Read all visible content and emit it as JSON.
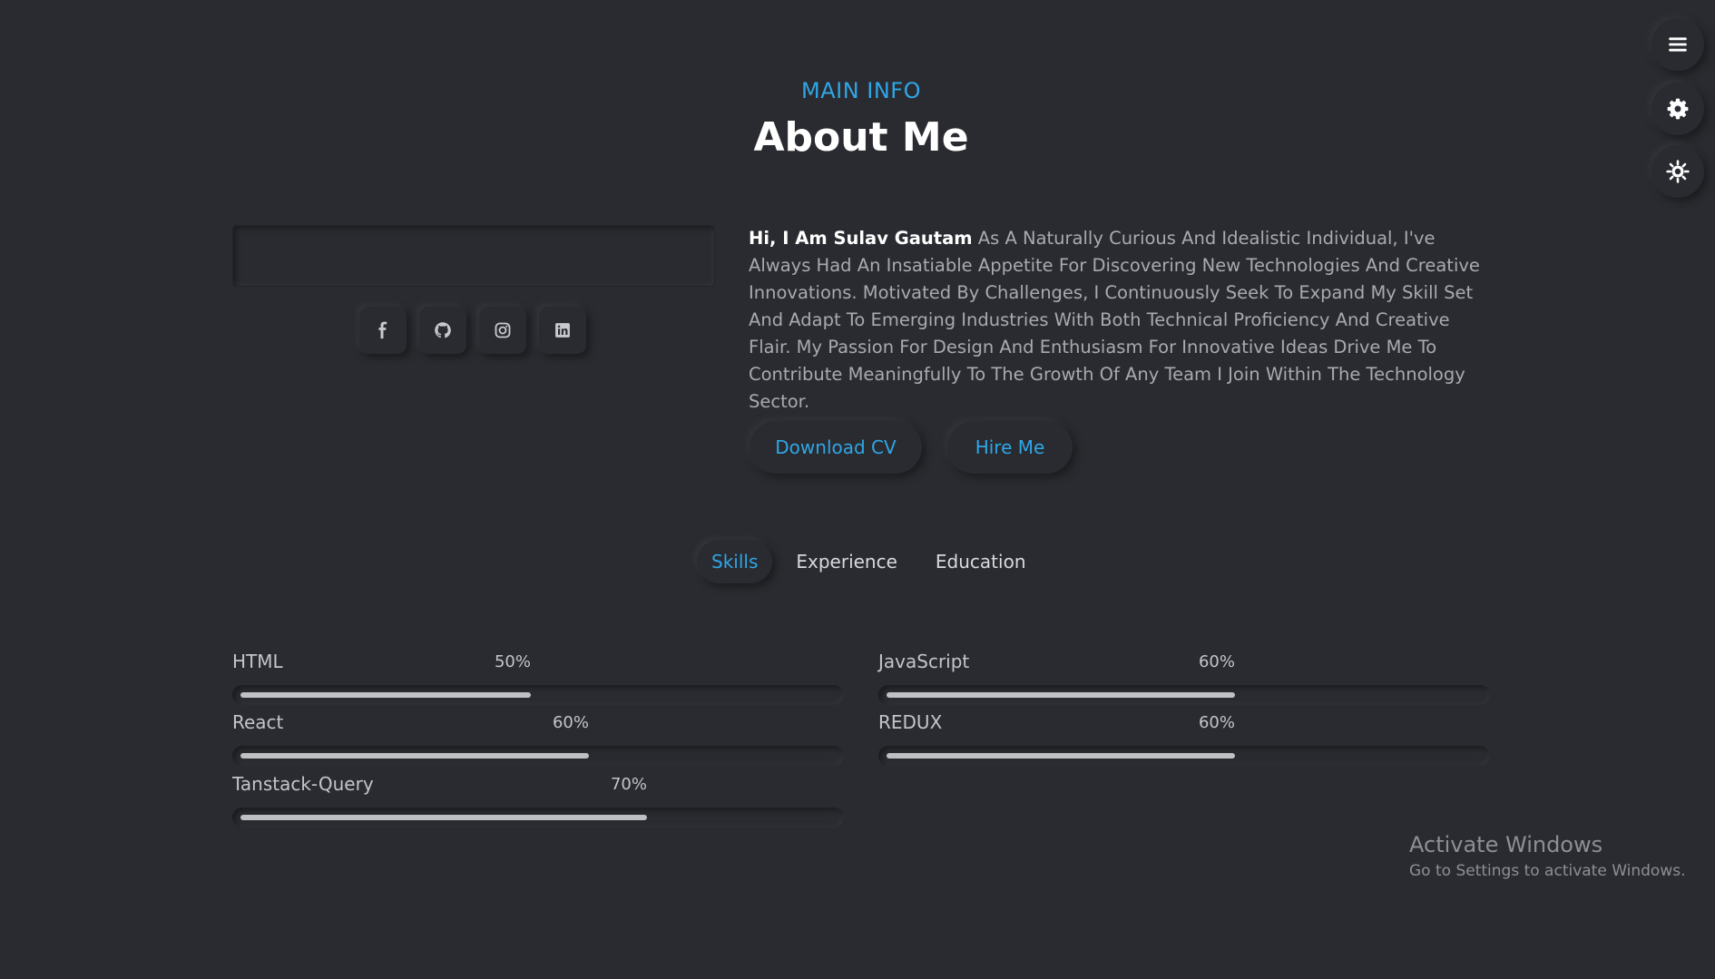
{
  "header": {
    "eyebrow": "MAIN INFO",
    "title": "About Me"
  },
  "side_buttons": [
    {
      "icon": "menu-icon"
    },
    {
      "icon": "gear-icon"
    },
    {
      "icon": "sun-icon"
    }
  ],
  "profile": {
    "socials": [
      {
        "icon": "facebook-icon"
      },
      {
        "icon": "github-icon"
      },
      {
        "icon": "instagram-icon"
      },
      {
        "icon": "linkedin-icon"
      }
    ]
  },
  "bio": {
    "intro": "Hi, I Am Sulav Gautam",
    "text": "As A Naturally Curious And Idealistic Individual, I've Always Had An Insatiable Appetite For Discovering New Technologies And Creative Innovations. Motivated By Challenges, I Continuously Seek To Expand My Skill Set And Adapt To Emerging Industries With Both Technical Proficiency And Creative Flair. My Passion For Design And Enthusiasm For Innovative Ideas Drive Me To Contribute Meaningfully To The Growth Of Any Team I Join Within The Technology Sector."
  },
  "buttons": {
    "download_cv": "Download CV",
    "hire_me": "Hire Me"
  },
  "tabs": [
    {
      "label": "Skills",
      "active": true
    },
    {
      "label": "Experience",
      "active": false
    },
    {
      "label": "Education",
      "active": false
    }
  ],
  "skills": [
    {
      "name": "HTML",
      "percent_label": "50%",
      "value": 50
    },
    {
      "name": "JavaScript",
      "percent_label": "60%",
      "value": 60
    },
    {
      "name": "React",
      "percent_label": "60%",
      "value": 60
    },
    {
      "name": "REDUX",
      "percent_label": "60%",
      "value": 60
    },
    {
      "name": "Tanstack-Query",
      "percent_label": "70%",
      "value": 70
    }
  ],
  "watermark": {
    "line1": "Activate Windows",
    "line2": "Go to Settings to activate Windows."
  },
  "colors": {
    "background": "#2a2b30",
    "accent": "#2fa6e6",
    "bar_fill": "#bfc0c4"
  }
}
